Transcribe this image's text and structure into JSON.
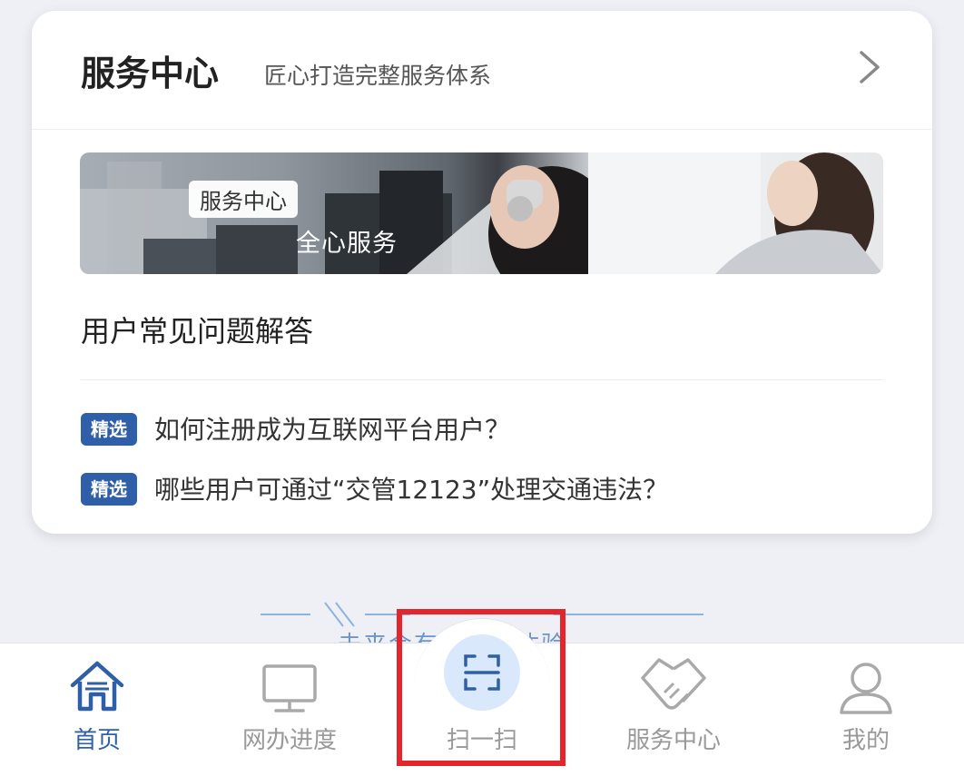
{
  "service_card": {
    "title": "服务中心",
    "subtitle": "匠心打造完整服务体系",
    "chevron_icon": "chevron-right-icon"
  },
  "banner": {
    "tag": "服务中心",
    "slogan": "全心服务"
  },
  "faq": {
    "heading": "用户常见问题解答",
    "items": [
      {
        "badge": "精选",
        "text": "如何注册成为互联网平台用户？"
      },
      {
        "badge": "精选",
        "text": "哪些用户可通过“交管12123”处理交通违法？"
      }
    ]
  },
  "footer_slogan": {
    "text": "未来会有更好的体验"
  },
  "tabbar": {
    "tabs": [
      {
        "label": "首页",
        "icon": "home-icon",
        "active": true
      },
      {
        "label": "网办进度",
        "icon": "monitor-icon",
        "active": false
      },
      {
        "label": "扫一扫",
        "icon": "scan-icon",
        "active": false
      },
      {
        "label": "服务中心",
        "icon": "handshake-icon",
        "active": false
      },
      {
        "label": "我的",
        "icon": "user-icon",
        "active": false
      }
    ]
  },
  "colors": {
    "accent": "#2f5fa8",
    "highlight": "#e5252c",
    "scan_bg": "#d9e8fb",
    "inactive": "#999999"
  }
}
